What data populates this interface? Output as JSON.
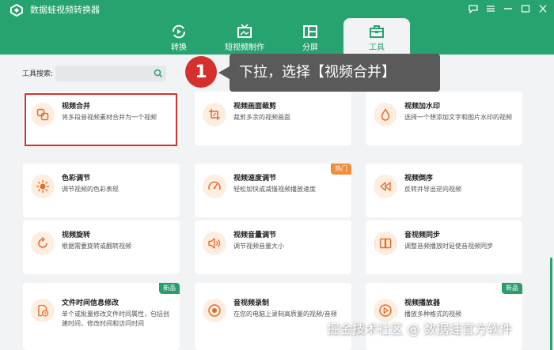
{
  "app": {
    "title": "数据蛙视频转换器"
  },
  "tabs": [
    {
      "label": "转换",
      "icon": "convert-icon"
    },
    {
      "label": "短视频制作",
      "icon": "tv-icon"
    },
    {
      "label": "分屏",
      "icon": "split-screen-icon"
    },
    {
      "label": "工具",
      "icon": "toolbox-icon",
      "active": true
    }
  ],
  "search": {
    "label": "工具搜索:",
    "value": ""
  },
  "cards": [
    {
      "title": "视频合并",
      "desc": "将多段音视频素材合并为一个视频",
      "icon": "merge-icon"
    },
    {
      "title": "视频画面裁剪",
      "desc": "裁剪多余的视频画面",
      "icon": "crop-icon"
    },
    {
      "title": "视频加水印",
      "desc": "选择一个想添加文字和图片水印的视频",
      "icon": "watermark-drop-icon"
    },
    {
      "title": "色彩调节",
      "desc": "调节视频的色彩表现",
      "icon": "color-sun-icon"
    },
    {
      "title": "视频速度调节",
      "desc": "轻松加快或减慢视频播放速度",
      "icon": "speedometer-icon",
      "badge": "热门"
    },
    {
      "title": "视频倒序",
      "desc": "反转并导出逆向视频",
      "icon": "rewind-icon"
    },
    {
      "title": "视频旋转",
      "desc": "根据需要旋转或翻转视频",
      "icon": "rotate-icon"
    },
    {
      "title": "视频音量调节",
      "desc": "调节视频音量大小",
      "icon": "volume-icon"
    },
    {
      "title": "音视频同步",
      "desc": "调整音频播放时延使音视频同步",
      "icon": "sync-icon"
    },
    {
      "title": "文件时间信息修改",
      "desc": "单个或批量修改文件时间属性，包括创建时间，修改时间和访问时间",
      "icon": "file-clock-icon",
      "badge": "新品"
    },
    {
      "title": "音视频录制",
      "desc": "在您的电脑上录制高质量的视频/音频",
      "icon": "record-icon"
    },
    {
      "title": "视频播放器",
      "desc": "播放多种格式的视频",
      "icon": "play-icon",
      "badge": "新品"
    }
  ],
  "callout": {
    "step": "1",
    "text": "下拉，选择【视频合并】"
  },
  "watermark": "掘金技术社区 @ 数据蛙官方软件",
  "colors": {
    "brand": "#26a36e",
    "accent": "#f08c3c",
    "highlight": "#d9302b"
  }
}
